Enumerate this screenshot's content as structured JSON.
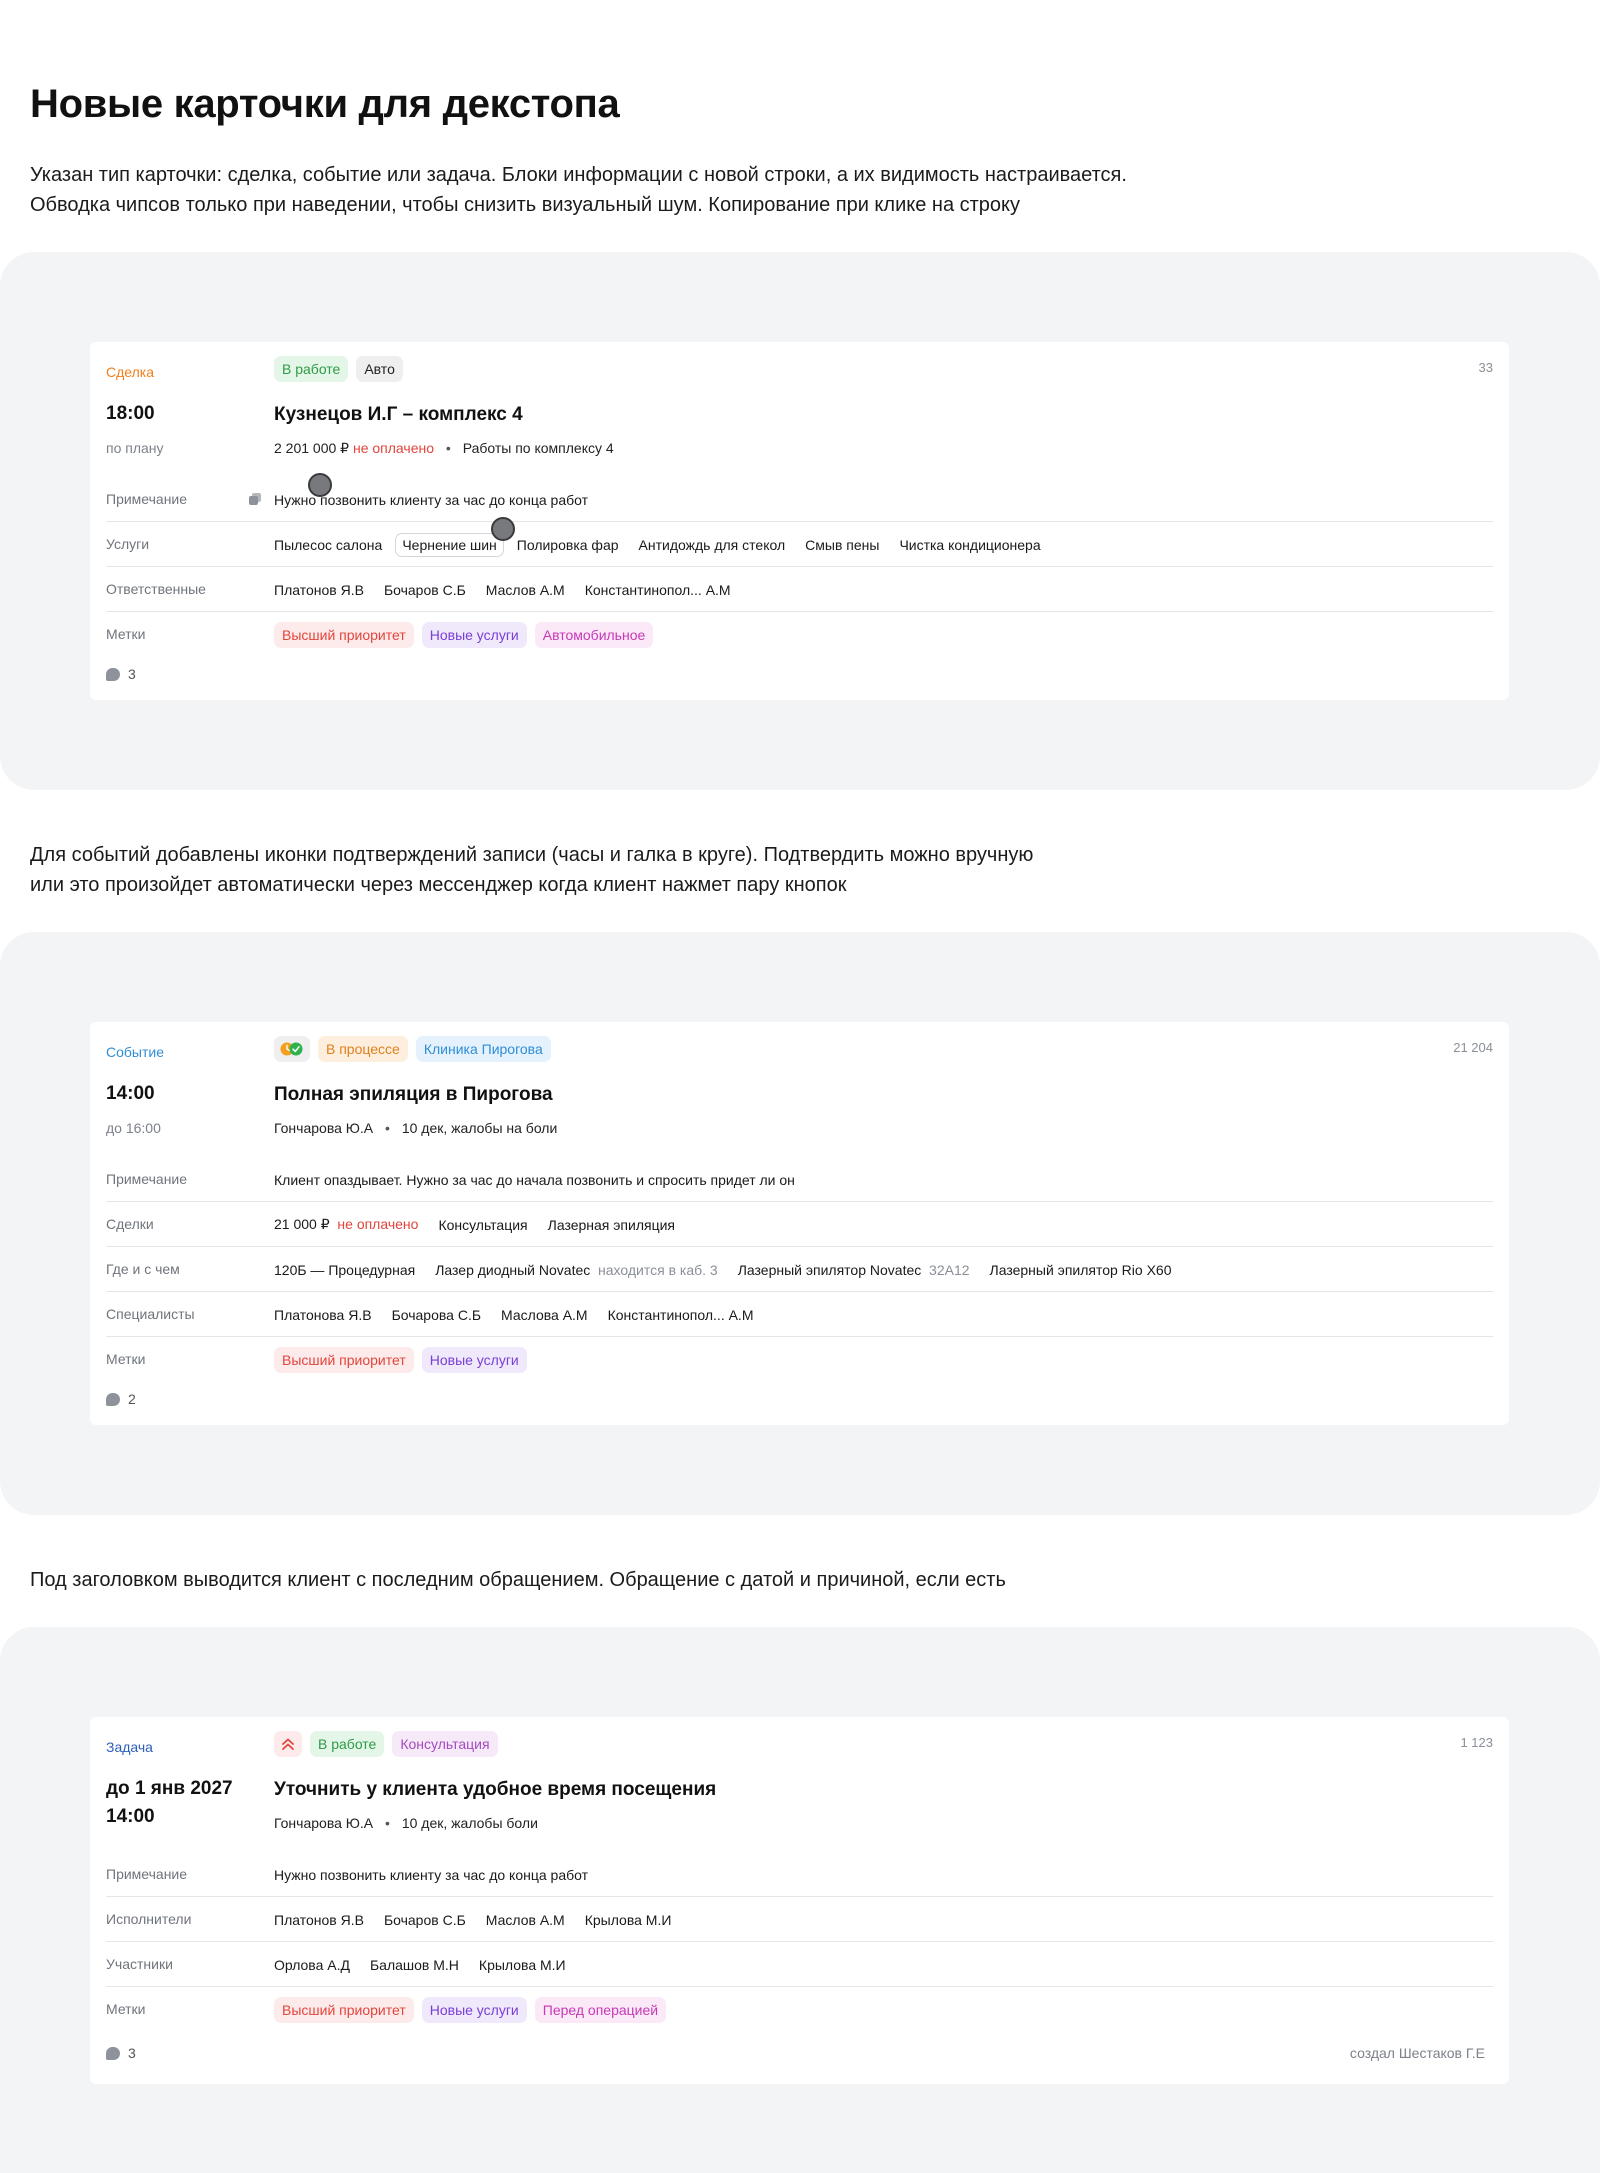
{
  "page": {
    "title": "Новые карточки для декстопа",
    "desc1": [
      "Указан тип карточки: сделка, событие или задача. Блоки информации с новой строки, а их видимость настраивается.",
      "Обводка чипсов только при наведении, чтобы снизить визуальный шум. Копирование при клике на строку"
    ],
    "desc2": [
      "Для событий добавлены иконки подтверждений записи (часы и галка в круге). Подтвердить можно вручную",
      "или это произойдет автоматически через мессенджер когда клиент нажмет пару кнопок"
    ],
    "desc3": [
      "Под заголовком выводится клиент с последним обращением. Обращение с датой и причиной, если есть"
    ]
  },
  "colors": {
    "deal": "#f07f1f",
    "event": "#2f8ed6",
    "task": "#2d5fb8",
    "section_bg": "#f3f4f6",
    "unpaid": "#e2453c"
  },
  "card1": {
    "type": "Сделка",
    "id": "33",
    "chips": [
      "В работе",
      "Авто"
    ],
    "time": "18:00",
    "time_sub": "по плану",
    "title": "Кузнецов И.Г – комплекс 4",
    "amount": "2 201 000 ₽",
    "payment": "не оплачено",
    "work": "Работы по комплексу 4",
    "rows": {
      "note_label": "Примечание",
      "note": "Нужно позвонить клиенту за час до конца работ",
      "services_label": "Услуги",
      "services": [
        "Пылесос салона",
        "Чернение шин",
        "Полировка фар",
        "Антидождь для стекол",
        "Смыв пены",
        "Чистка кондиционера"
      ],
      "resp_label": "Ответственные",
      "resp": [
        "Платонов Я.В",
        "Бочаров С.Б",
        "Маслов А.М",
        "Константинопол... А.М"
      ],
      "tags_label": "Метки",
      "tags": [
        "Высший приоритет",
        "Новые услуги",
        "Автомобильное"
      ]
    },
    "comments": "3"
  },
  "card2": {
    "type": "Событие",
    "id": "21 204",
    "chips": [
      "В процессе",
      "Клиника Пирогова"
    ],
    "confirm_icons": [
      "clock-icon",
      "check-circle-icon"
    ],
    "time": "14:00",
    "time_sub": "до 16:00",
    "title": "Полная эпиляция в Пирогова",
    "client": "Гончарова Ю.А",
    "appeal": "10 дек, жалобы на боли",
    "rows": {
      "note_label": "Примечание",
      "note": "Клиент опаздывает. Нужно за час до начала позвонить и спросить придет ли он",
      "deals_label": "Сделки",
      "deal_amount": "21 000 ₽",
      "deal_payment": "не оплачено",
      "deals": [
        "Консультация",
        "Лазерная эпиляция"
      ],
      "where_label": "Где и с чем",
      "room": "120Б — Процедурная",
      "eq1": "Лазер диодный Novatec",
      "eq1_note": "находится в каб. 3",
      "eq2": "Лазерный эпилятор Novatec",
      "eq2_code": "32А12",
      "eq3": "Лазерный эпилятор Rio X60",
      "spec_label": "Специалисты",
      "spec": [
        "Платонова Я.В",
        "Бочарова С.Б",
        "Маслова А.М",
        "Константинопол... А.М"
      ],
      "tags_label": "Метки",
      "tags": [
        "Высший приоритет",
        "Новые услуги"
      ]
    },
    "comments": "2"
  },
  "card3": {
    "type": "Задача",
    "id": "1 123",
    "priority_icon": "double-chevron-up-icon",
    "chips": [
      "В работе",
      "Консультация"
    ],
    "time_line1": "до 1 янв 2027",
    "time_line2": "14:00",
    "title": "Уточнить у клиента удобное время посещения",
    "client": "Гончарова Ю.А",
    "appeal": "10 дек, жалобы боли",
    "rows": {
      "note_label": "Примечание",
      "note": "Нужно позвонить клиенту за час до конца работ",
      "exec_label": "Исполнители",
      "exec": [
        "Платонов Я.В",
        "Бочаров С.Б",
        "Маслов А.М",
        "Крылова М.И"
      ],
      "part_label": "Участники",
      "part": [
        "Орлова А.Д",
        "Балашов М.Н",
        "Крылова М.И"
      ],
      "tags_label": "Метки",
      "tags": [
        "Высший приоритет",
        "Новые услуги",
        "Перед операцией"
      ]
    },
    "comments": "3",
    "creator": "создал Шестаков Г.Е"
  }
}
